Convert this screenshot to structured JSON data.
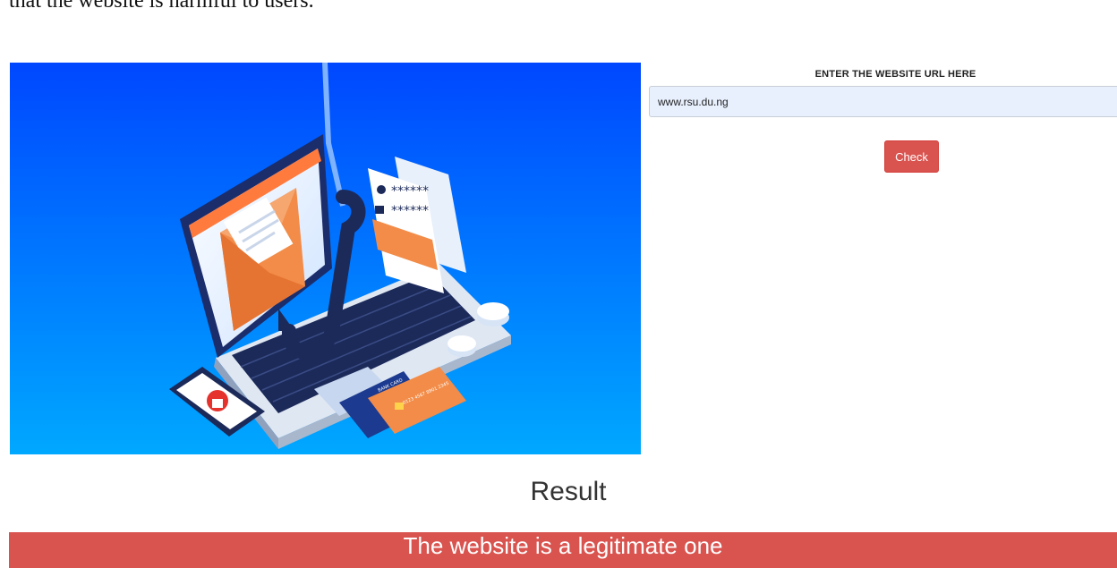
{
  "document": {
    "caption_fragment": "that the website is harmful to users."
  },
  "hero_image": {
    "icon": "phishing-laptop-illustration",
    "card_label": "BANK CARD",
    "card_number_fragment": "0123 4567 8901 2345",
    "password_mask": "******",
    "colors": {
      "bg_top": "#0047ff",
      "bg_bottom": "#00a8ff",
      "envelope": "#f28c48"
    }
  },
  "form": {
    "label": "ENTER THE WEBSITE URL HERE",
    "url_value": "www.rsu.du.ng",
    "check_label": "Check"
  },
  "result": {
    "heading": "Result",
    "message": "The website is a legitimate one",
    "color": "#d9534f"
  }
}
